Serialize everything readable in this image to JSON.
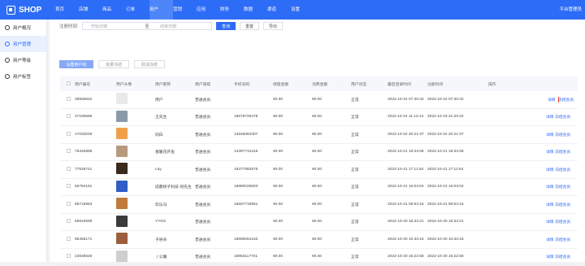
{
  "brand": "SHOP",
  "nav": [
    "首页",
    "店铺",
    "商品",
    "订单",
    "用户",
    "营销",
    "应用",
    "财务",
    "数据",
    "渠道",
    "设置"
  ],
  "nav_active": 4,
  "top_right": "平台管理员",
  "sidebar": [
    {
      "label": "用户概况",
      "icon": "user-icon"
    },
    {
      "label": "用户管理",
      "icon": "user-manage-icon"
    },
    {
      "label": "用户等级",
      "icon": "level-icon"
    },
    {
      "label": "用户标签",
      "icon": "tag-icon"
    }
  ],
  "sidebar_active": 1,
  "filter": {
    "label": "注册时间",
    "start": "开始日期",
    "sep": "至",
    "end": "结束日期",
    "query": "查询",
    "reset": "重置",
    "export": "导出"
  },
  "actions": {
    "set_tag": "设置用户标签",
    "batch_freeze": "批量冻结",
    "cancel_freeze": "取消冻结"
  },
  "headers": [
    "用户编号",
    "用户头像",
    "用户昵称",
    "用户等级",
    "手机号码",
    "储值金额",
    "消费金额",
    "用户状态",
    "最后登录时间",
    "注册时间",
    "操作"
  ],
  "row_actions": {
    "detail": "详情",
    "freeze": "冻结会员"
  },
  "rows": [
    {
      "id": "48569622",
      "nickname": "用户",
      "level": "普通会员",
      "phone": "",
      "balance": "¥0.00",
      "spent": "¥0.00",
      "status": "正常",
      "last_login": "2022-10-24 07:30:42",
      "registered": "2022-10-24 07:30:42",
      "avatar_color": "#e9e9e9"
    },
    {
      "id": "47186666",
      "nickname": "王先生",
      "level": "普通会员",
      "phone": "18678729478",
      "balance": "¥0.00",
      "spent": "¥0.00",
      "status": "正常",
      "last_login": "2022-10-24 11:13:14",
      "registered": "2022-10-23 21:20:22",
      "avatar_color": "#8a9aa8"
    },
    {
      "id": "17033049",
      "nickname": "同白",
      "level": "普通会员",
      "phone": "13646084307",
      "balance": "¥0.00",
      "spent": "¥0.00",
      "status": "正常",
      "last_login": "2022-10-22 20:21:37",
      "registered": "2022-10-22 20:21:37",
      "avatar_color": "#f0a04b"
    },
    {
      "id": "76425858",
      "nickname": "春暖花开鱼",
      "level": "普通会员",
      "phone": "13397713416",
      "balance": "¥0.00",
      "spent": "¥0.00",
      "status": "正常",
      "last_login": "2022-10-21 19:34:08",
      "registered": "2022-10-21 19:32:08",
      "avatar_color": "#b79a7e"
    },
    {
      "id": "77536741",
      "nickname": "Lay",
      "level": "普通会员",
      "phone": "18377582575",
      "balance": "¥0.00",
      "spent": "¥0.00",
      "status": "正常",
      "last_login": "2022-10-21 17:11:54",
      "registered": "2022-10-21 17:11:54",
      "avatar_color": "#3a2a1e"
    },
    {
      "id": "56794181",
      "nickname": "成都榜子科技-何先生",
      "level": "普通会员",
      "phone": "18980026603",
      "balance": "¥0.00",
      "spent": "¥0.00",
      "status": "正常",
      "last_login": "2022-10-21 15:03:04",
      "registered": "2022-10-21 15:03:04",
      "avatar_color": "#2f5ec4"
    },
    {
      "id": "85715963",
      "nickname": "欢乐马",
      "level": "普通会员",
      "phone": "15507716951",
      "balance": "¥0.00",
      "spent": "¥0.00",
      "status": "正常",
      "last_login": "2022-10-21 09:54:16",
      "registered": "2022-10-21 09:54:16",
      "avatar_color": "#c07a3a"
    },
    {
      "id": "65815599",
      "nickname": "YYDS",
      "level": "普通会员",
      "phone": "",
      "balance": "¥0.00",
      "spent": "¥0.00",
      "status": "正常",
      "last_login": "2022-10-20 16:34:21",
      "registered": "2022-10-20 16:34:21",
      "avatar_color": "#3b3b3b"
    },
    {
      "id": "85458171",
      "nickname": "子俗朵",
      "level": "普通会员",
      "phone": "18699264152",
      "balance": "¥0.00",
      "spent": "¥0.00",
      "status": "正常",
      "last_login": "2022-10-20 10:33:16",
      "registered": "2022-10-20 10:33:16",
      "avatar_color": "#9c5f3d"
    },
    {
      "id": "23836626",
      "nickname": "丿公瞳",
      "level": "普通会员",
      "phone": "15963117701",
      "balance": "¥0.00",
      "spent": "¥0.00",
      "status": "正常",
      "last_login": "2022-10-20 16:22:58",
      "registered": "2022-10-20 16:22:58",
      "avatar_color": "#cfcfcf"
    }
  ]
}
